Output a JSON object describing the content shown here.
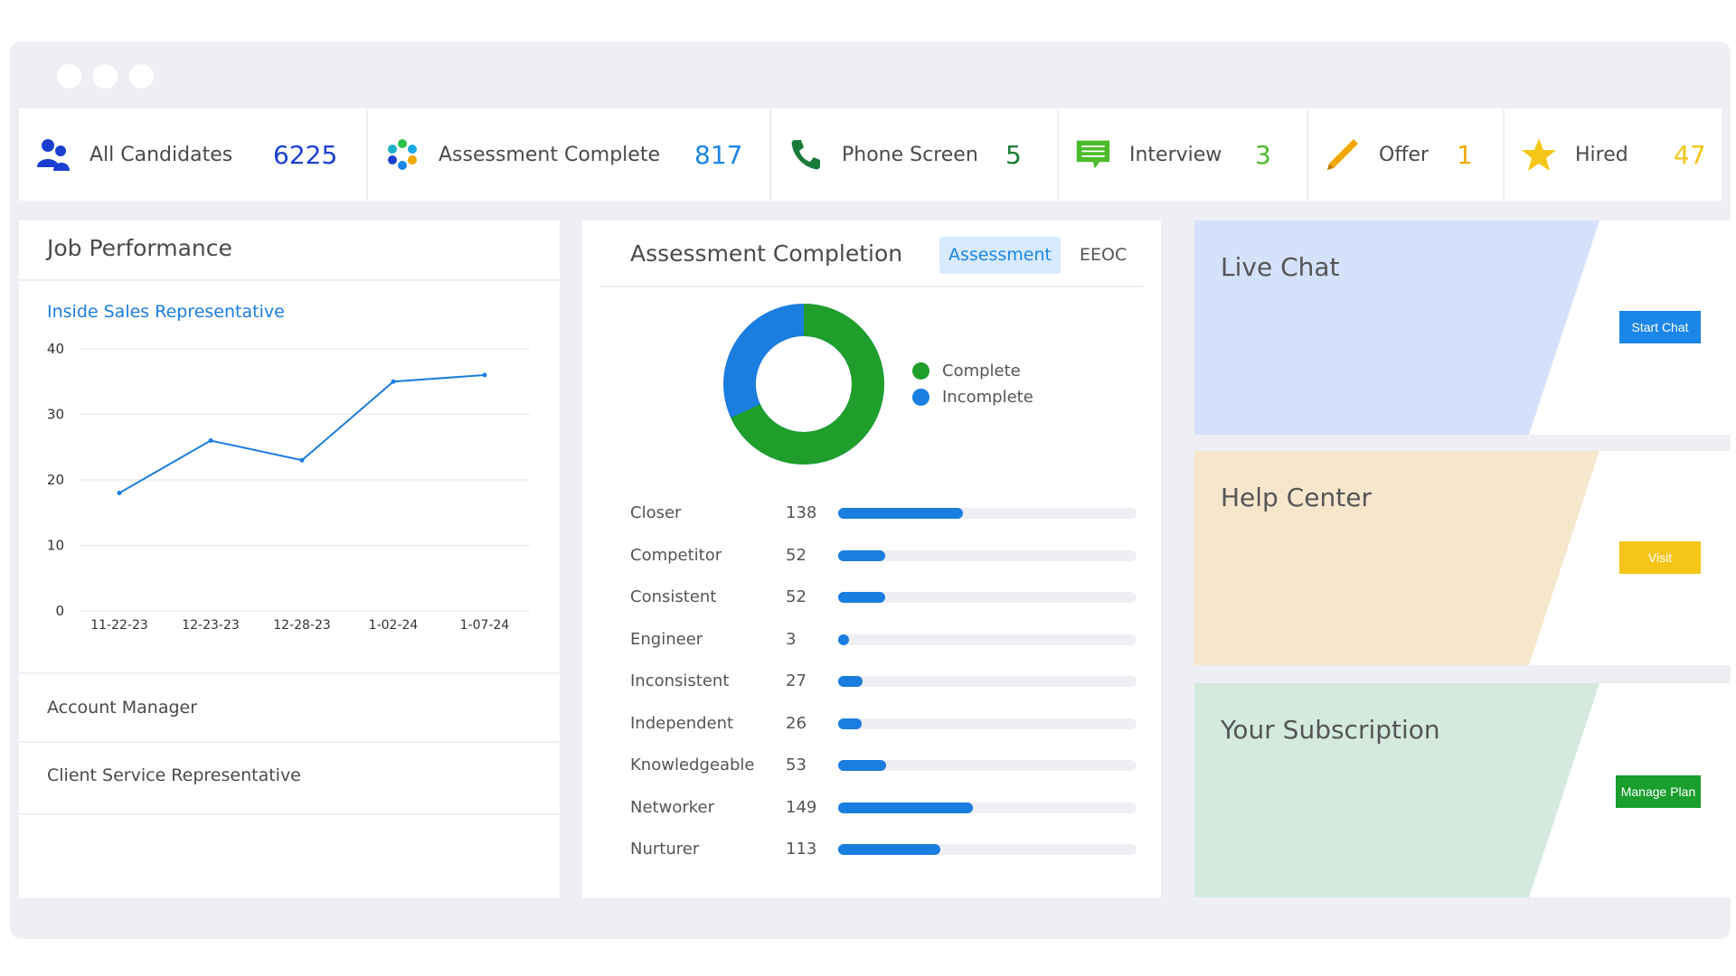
{
  "stats": [
    {
      "label": "All Candidates",
      "value": "6225",
      "icon": "users-icon",
      "color": "#1a3fd0"
    },
    {
      "label": "Assessment Complete",
      "value": "817",
      "icon": "flower-icon",
      "color": "#1a86e8"
    },
    {
      "label": "Phone Screen",
      "value": "5",
      "icon": "phone-icon",
      "color": "#1a7a3a"
    },
    {
      "label": "Interview",
      "value": "3",
      "icon": "chat-icon",
      "color": "#4cbb2a"
    },
    {
      "label": "Offer",
      "value": "1",
      "icon": "pencil-icon",
      "color": "#f0a800"
    },
    {
      "label": "Hired",
      "value": "47",
      "icon": "star-icon",
      "color": "#f5c518"
    }
  ],
  "job_performance": {
    "title": "Job Performance",
    "selected_job": "Inside Sales Representative",
    "other_jobs": [
      "Account Manager",
      "Client Service Representative"
    ]
  },
  "chart_data": {
    "type": "line",
    "categories": [
      "11-22-23",
      "12-23-23",
      "12-28-23",
      "1-02-24",
      "1-07-24"
    ],
    "values": [
      18,
      26,
      23,
      35,
      36
    ],
    "yticks": [
      0,
      10,
      20,
      30,
      40
    ],
    "ylim": [
      0,
      40
    ],
    "color": "#1a7de0",
    "grid": true
  },
  "assessment": {
    "title": "Assessment Completion",
    "tabs": [
      "Assessment",
      "EEOC"
    ],
    "donut": {
      "complete": 817,
      "incomplete": 383
    },
    "legend": [
      {
        "label": "Complete",
        "color": "#1f9e2b"
      },
      {
        "label": "Incomplete",
        "color": "#1a7de0"
      }
    ],
    "traits": [
      {
        "name": "Closer",
        "value": 138
      },
      {
        "name": "Competitor",
        "value": 52
      },
      {
        "name": "Consistent",
        "value": 52
      },
      {
        "name": "Engineer",
        "value": 3
      },
      {
        "name": "Inconsistent",
        "value": 27
      },
      {
        "name": "Independent",
        "value": 26
      },
      {
        "name": "Knowledgeable",
        "value": 53
      },
      {
        "name": "Networker",
        "value": 149
      },
      {
        "name": "Nurturer",
        "value": 113
      }
    ],
    "trait_max": 330
  },
  "cards": [
    {
      "title": "Live Chat",
      "button": "Start Chat",
      "bg": "#d4e1fb",
      "btn_color": "#1a86e8"
    },
    {
      "title": "Help Center",
      "button": "Visit",
      "bg": "#f6e6cc",
      "btn_color": "#f5c518"
    },
    {
      "title": "Your Subscription",
      "button": "Manage Plan",
      "bg": "#d4eadf",
      "btn_color": "#1a9e2e"
    }
  ]
}
